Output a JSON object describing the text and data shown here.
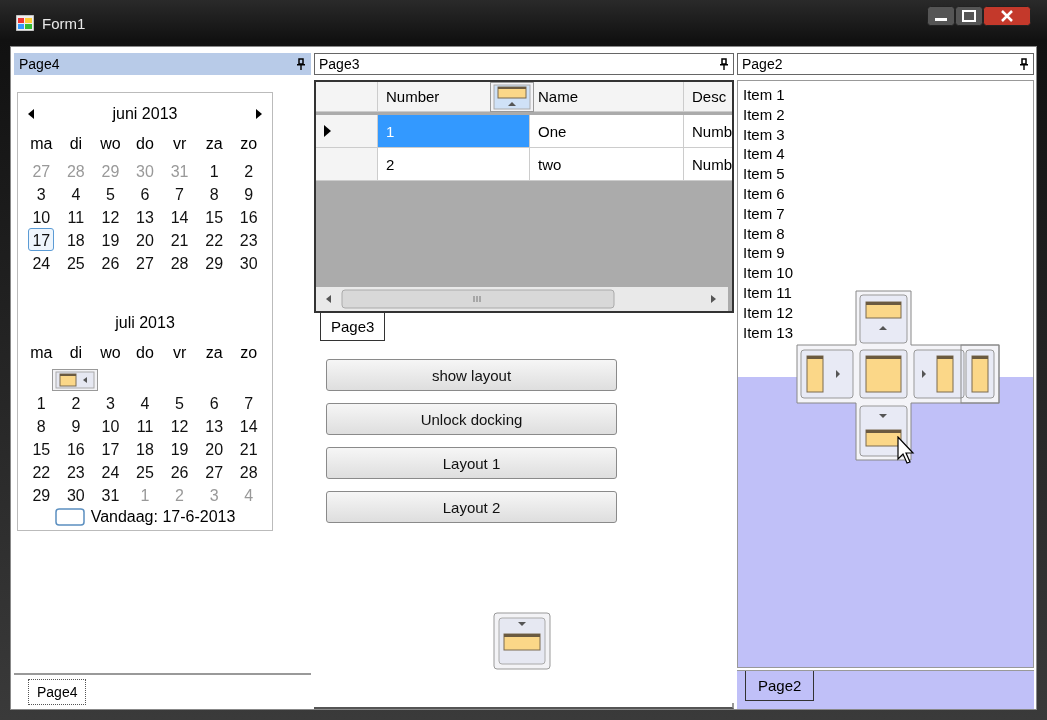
{
  "window": {
    "title": "Form1"
  },
  "left_pane": {
    "caption": "Page4",
    "active": true,
    "calendar": {
      "months": [
        {
          "title": "juni 2013",
          "weekdays": [
            "ma",
            "di",
            "wo",
            "do",
            "vr",
            "za",
            "zo"
          ],
          "blank_first_row": false,
          "weeks": [
            [
              {
                "d": "27",
                "other": true,
                "selected": false
              },
              {
                "d": "28",
                "other": true,
                "selected": false
              },
              {
                "d": "29",
                "other": true,
                "selected": false
              },
              {
                "d": "30",
                "other": true,
                "selected": false
              },
              {
                "d": "31",
                "other": true,
                "selected": false
              },
              {
                "d": "1",
                "other": false,
                "selected": false
              },
              {
                "d": "2",
                "other": false,
                "selected": false
              }
            ],
            [
              {
                "d": "3",
                "other": false,
                "selected": false
              },
              {
                "d": "4",
                "other": false,
                "selected": false
              },
              {
                "d": "5",
                "other": false,
                "selected": false
              },
              {
                "d": "6",
                "other": false,
                "selected": false
              },
              {
                "d": "7",
                "other": false,
                "selected": false
              },
              {
                "d": "8",
                "other": false,
                "selected": false
              },
              {
                "d": "9",
                "other": false,
                "selected": false
              }
            ],
            [
              {
                "d": "10",
                "other": false,
                "selected": false
              },
              {
                "d": "11",
                "other": false,
                "selected": false
              },
              {
                "d": "12",
                "other": false,
                "selected": false
              },
              {
                "d": "13",
                "other": false,
                "selected": false
              },
              {
                "d": "14",
                "other": false,
                "selected": false
              },
              {
                "d": "15",
                "other": false,
                "selected": false
              },
              {
                "d": "16",
                "other": false,
                "selected": false
              }
            ],
            [
              {
                "d": "17",
                "other": false,
                "selected": true
              },
              {
                "d": "18",
                "other": false,
                "selected": false
              },
              {
                "d": "19",
                "other": false,
                "selected": false
              },
              {
                "d": "20",
                "other": false,
                "selected": false
              },
              {
                "d": "21",
                "other": false,
                "selected": false
              },
              {
                "d": "22",
                "other": false,
                "selected": false
              },
              {
                "d": "23",
                "other": false,
                "selected": false
              }
            ],
            [
              {
                "d": "24",
                "other": false,
                "selected": false
              },
              {
                "d": "25",
                "other": false,
                "selected": false
              },
              {
                "d": "26",
                "other": false,
                "selected": false
              },
              {
                "d": "27",
                "other": false,
                "selected": false
              },
              {
                "d": "28",
                "other": false,
                "selected": false
              },
              {
                "d": "29",
                "other": false,
                "selected": false
              },
              {
                "d": "30",
                "other": false,
                "selected": false
              }
            ]
          ]
        },
        {
          "title": "juli 2013",
          "weekdays": [
            "ma",
            "di",
            "wo",
            "do",
            "vr",
            "za",
            "zo"
          ],
          "blank_first_row": true,
          "weeks": [
            [
              {
                "d": "1",
                "other": false,
                "selected": false
              },
              {
                "d": "2",
                "other": false,
                "selected": false
              },
              {
                "d": "3",
                "other": false,
                "selected": false
              },
              {
                "d": "4",
                "other": false,
                "selected": false
              },
              {
                "d": "5",
                "other": false,
                "selected": false
              },
              {
                "d": "6",
                "other": false,
                "selected": false
              },
              {
                "d": "7",
                "other": false,
                "selected": false
              }
            ],
            [
              {
                "d": "8",
                "other": false,
                "selected": false
              },
              {
                "d": "9",
                "other": false,
                "selected": false
              },
              {
                "d": "10",
                "other": false,
                "selected": false
              },
              {
                "d": "11",
                "other": false,
                "selected": false
              },
              {
                "d": "12",
                "other": false,
                "selected": false
              },
              {
                "d": "13",
                "other": false,
                "selected": false
              },
              {
                "d": "14",
                "other": false,
                "selected": false
              }
            ],
            [
              {
                "d": "15",
                "other": false,
                "selected": false
              },
              {
                "d": "16",
                "other": false,
                "selected": false
              },
              {
                "d": "17",
                "other": false,
                "selected": false
              },
              {
                "d": "18",
                "other": false,
                "selected": false
              },
              {
                "d": "19",
                "other": false,
                "selected": false
              },
              {
                "d": "20",
                "other": false,
                "selected": false
              },
              {
                "d": "21",
                "other": false,
                "selected": false
              }
            ],
            [
              {
                "d": "22",
                "other": false,
                "selected": false
              },
              {
                "d": "23",
                "other": false,
                "selected": false
              },
              {
                "d": "24",
                "other": false,
                "selected": false
              },
              {
                "d": "25",
                "other": false,
                "selected": false
              },
              {
                "d": "26",
                "other": false,
                "selected": false
              },
              {
                "d": "27",
                "other": false,
                "selected": false
              },
              {
                "d": "28",
                "other": false,
                "selected": false
              }
            ],
            [
              {
                "d": "29",
                "other": false,
                "selected": false
              },
              {
                "d": "30",
                "other": false,
                "selected": false
              },
              {
                "d": "31",
                "other": false,
                "selected": false
              },
              {
                "d": "1",
                "other": true,
                "selected": false
              },
              {
                "d": "2",
                "other": true,
                "selected": false
              },
              {
                "d": "3",
                "other": true,
                "selected": false
              },
              {
                "d": "4",
                "other": true,
                "selected": false
              }
            ]
          ]
        }
      ],
      "today_label": "Vandaag: 17-6-2013"
    },
    "tab": {
      "label": "Page4",
      "selected": true
    }
  },
  "middle_pane": {
    "caption": "Page3",
    "active": false,
    "grid": {
      "columns": [
        "Number",
        "Name",
        "Desc"
      ],
      "rows": [
        {
          "cells": [
            "1",
            "One",
            "Numb"
          ],
          "selected": true
        },
        {
          "cells": [
            "2",
            "two",
            "Numb"
          ],
          "selected": false
        }
      ]
    },
    "tab": {
      "label": "Page3",
      "selected": true
    },
    "buttons": [
      "show layout",
      "Unlock docking",
      "Layout 1",
      "Layout 2"
    ]
  },
  "right_pane": {
    "caption": "Page2",
    "active": false,
    "dock_preview": true,
    "list": [
      "Item 1",
      "Item 2",
      "Item 3",
      "Item 4",
      "Item 5",
      "Item 6",
      "Item 7",
      "Item 8",
      "Item 9",
      "Item 10",
      "Item 11",
      "Item 12",
      "Item 13"
    ],
    "tab": {
      "label": "Page2",
      "selected": true
    }
  }
}
